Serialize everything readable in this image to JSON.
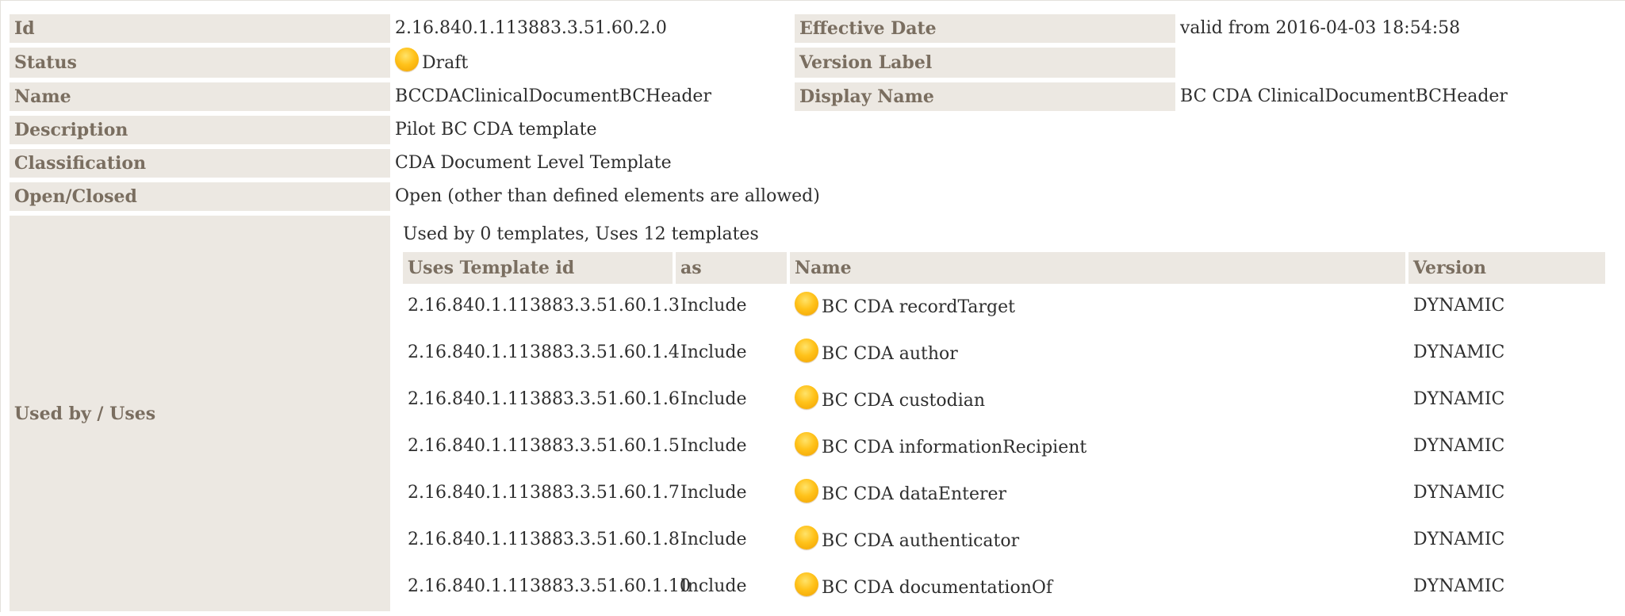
{
  "fields": {
    "id": {
      "label": "Id",
      "value": "2.16.840.1.113883.3.51.60.2.0"
    },
    "effective_date": {
      "label": "Effective Date",
      "value": "valid from 2016-04-03 18:54:58"
    },
    "status": {
      "label": "Status",
      "value": "Draft"
    },
    "version_label": {
      "label": "Version Label",
      "value": ""
    },
    "name": {
      "label": "Name",
      "value": "BCCDAClinicalDocumentBCHeader"
    },
    "display_name": {
      "label": "Display Name",
      "value": "BC CDA ClinicalDocumentBCHeader"
    },
    "description": {
      "label": "Description",
      "value": "Pilot BC CDA template"
    },
    "classification": {
      "label": "Classification",
      "value": "CDA Document Level Template"
    },
    "open_closed": {
      "label": "Open/Closed",
      "value": "Open (other than defined elements are allowed)"
    }
  },
  "uses_section": {
    "label": "Used by / Uses",
    "summary": "Used by 0 templates, Uses 12 templates",
    "columns": [
      "Uses Template id",
      "as",
      "Name",
      "Version"
    ],
    "rows": [
      {
        "id": "2.16.840.1.113883.3.51.60.1.3",
        "as": "Include",
        "name": "BC CDA recordTarget",
        "version": "DYNAMIC"
      },
      {
        "id": "2.16.840.1.113883.3.51.60.1.4",
        "as": "Include",
        "name": "BC CDA author",
        "version": "DYNAMIC"
      },
      {
        "id": "2.16.840.1.113883.3.51.60.1.6",
        "as": "Include",
        "name": "BC CDA custodian",
        "version": "DYNAMIC"
      },
      {
        "id": "2.16.840.1.113883.3.51.60.1.5",
        "as": "Include",
        "name": "BC CDA informationRecipient",
        "version": "DYNAMIC"
      },
      {
        "id": "2.16.840.1.113883.3.51.60.1.7",
        "as": "Include",
        "name": "BC CDA dataEnterer",
        "version": "DYNAMIC"
      },
      {
        "id": "2.16.840.1.113883.3.51.60.1.8",
        "as": "Include",
        "name": "BC CDA authenticator",
        "version": "DYNAMIC"
      },
      {
        "id": "2.16.840.1.113883.3.51.60.1.10",
        "as": "Include",
        "name": "BC CDA documentationOf",
        "version": "DYNAMIC"
      }
    ]
  },
  "colors": {
    "label_bg": "#ece8e2",
    "label_text": "#7a6e60",
    "status_draft": "#ffc21a"
  },
  "icons": {
    "status": "draft-status-icon"
  }
}
